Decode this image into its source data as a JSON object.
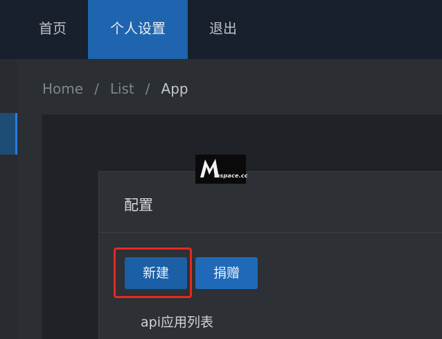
{
  "nav": {
    "items": [
      {
        "label": "首页"
      },
      {
        "label": "个人设置"
      },
      {
        "label": "退出"
      }
    ],
    "active_index": 1
  },
  "breadcrumb": {
    "items": [
      "Home",
      "List",
      "App"
    ],
    "separator": "/"
  },
  "watermark": {
    "text": "mspace.cc"
  },
  "card": {
    "title": "配置",
    "buttons": {
      "new_label": "新建",
      "donate_label": "捐赠"
    },
    "list_label": "api应用列表"
  },
  "colors": {
    "accent": "#1e64ae",
    "highlight": "#e52a22"
  }
}
